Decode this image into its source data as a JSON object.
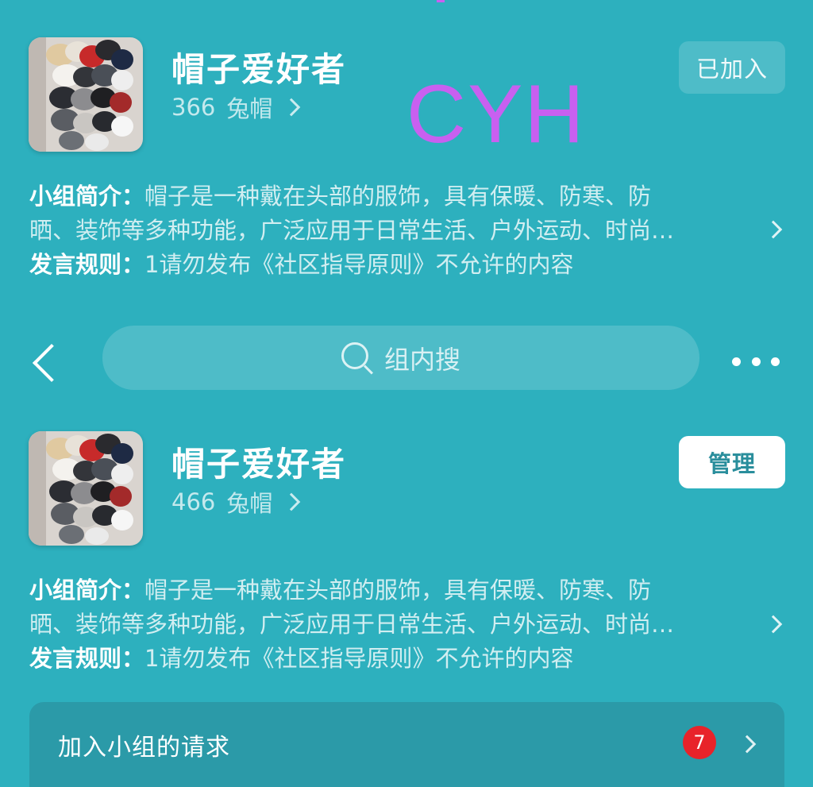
{
  "watermark": "CYH",
  "group_top": {
    "name": "帽子爱好者",
    "member_count": "366",
    "member_unit": "兔帽",
    "join_button": "已加入",
    "intro_label": "小组简介：",
    "intro_line1": "帽子是一种戴在头部的服饰，具有保暖、防寒、防",
    "intro_line2": "晒、装饰等多种功能，广泛应用于日常生活、户外运动、时尚…",
    "rules_label": "发言规则：",
    "rules_text": "1请勿发布《社区指导原则》不允许的内容"
  },
  "search": {
    "placeholder": "组内搜"
  },
  "group_bottom": {
    "name": "帽子爱好者",
    "member_count": "466",
    "member_unit": "兔帽",
    "manage_button": "管理",
    "intro_label": "小组简介：",
    "intro_line1": "帽子是一种戴在头部的服饰，具有保暖、防寒、防",
    "intro_line2": "晒、装饰等多种功能，广泛应用于日常生活、户外运动、时尚…",
    "rules_label": "发言规则：",
    "rules_text": "1请勿发布《社区指导原则》不允许的内容"
  },
  "requests": {
    "label": "加入小组的请求",
    "badge_count": "7"
  },
  "icons": {
    "back": "back-chevron-icon",
    "search": "search-icon",
    "more": "more-dots-icon",
    "chevron": "chevron-right-icon"
  },
  "colors": {
    "background": "#2DB0BE",
    "watermark": "#C860F0",
    "badge": "#E8232A",
    "manage_text": "#2A8E9C"
  }
}
